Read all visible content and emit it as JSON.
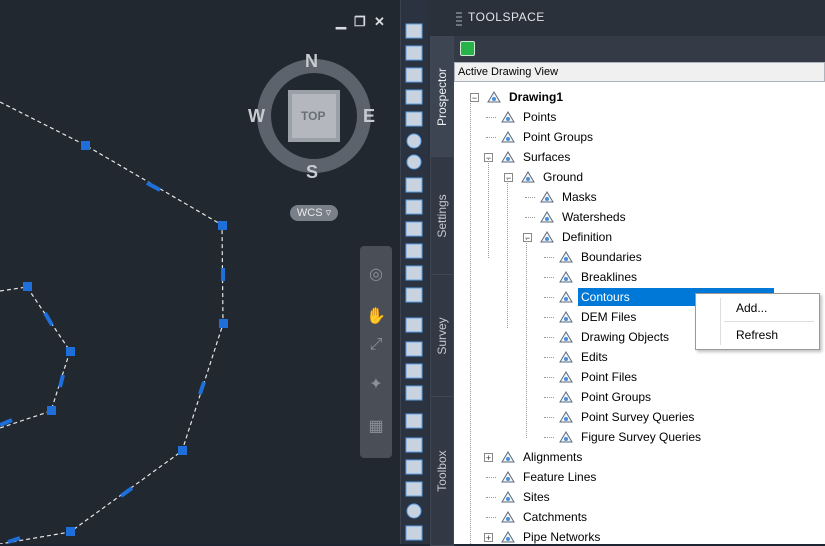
{
  "viewport": {
    "win_minimize": "▁",
    "win_restore": "❐",
    "win_close": "✕",
    "viewcube": {
      "north": "N",
      "south": "S",
      "east": "E",
      "west": "W",
      "face": "TOP"
    },
    "wcs_label": "WCS ▿",
    "navbar_icons": [
      "steering-wheel-icon",
      "pan-icon",
      "zoom-extents-icon",
      "orbit-icon",
      "showmotion-icon"
    ]
  },
  "toolspace": {
    "title": "TOOLSPACE",
    "tabs": [
      "Prospector",
      "Settings",
      "Survey",
      "Toolbox"
    ],
    "active_tab": "Prospector",
    "view_selector": "Active Drawing View",
    "tree": [
      {
        "label": "Drawing1",
        "level": 0,
        "expander": "−",
        "icon": "drawing-icon",
        "bold": true
      },
      {
        "label": "Points",
        "level": 1,
        "expander": "",
        "icon": "points-icon"
      },
      {
        "label": "Point Groups",
        "level": 1,
        "expander": "",
        "icon": "point-groups-icon"
      },
      {
        "label": "Surfaces",
        "level": 1,
        "expander": "−",
        "icon": "surfaces-icon"
      },
      {
        "label": "Ground",
        "level": 2,
        "expander": "−",
        "icon": "surface-icon"
      },
      {
        "label": "Masks",
        "level": 3,
        "expander": "",
        "icon": "masks-icon"
      },
      {
        "label": "Watersheds",
        "level": 3,
        "expander": "",
        "icon": "watersheds-icon"
      },
      {
        "label": "Definition",
        "level": 3,
        "expander": "−",
        "icon": "definition-icon"
      },
      {
        "label": "Boundaries",
        "level": 4,
        "expander": "",
        "icon": "boundaries-icon"
      },
      {
        "label": "Breaklines",
        "level": 4,
        "expander": "",
        "icon": "breaklines-icon"
      },
      {
        "label": "Contours",
        "level": 4,
        "expander": "",
        "icon": "contours-icon",
        "selected": true
      },
      {
        "label": "DEM Files",
        "level": 4,
        "expander": "",
        "icon": "dem-files-icon"
      },
      {
        "label": "Drawing Objects",
        "level": 4,
        "expander": "",
        "icon": "drawing-objects-icon"
      },
      {
        "label": "Edits",
        "level": 4,
        "expander": "",
        "icon": "edits-icon"
      },
      {
        "label": "Point Files",
        "level": 4,
        "expander": "",
        "icon": "point-files-icon"
      },
      {
        "label": "Point Groups",
        "level": 4,
        "expander": "",
        "icon": "point-groups-icon"
      },
      {
        "label": "Point Survey Queries",
        "level": 4,
        "expander": "",
        "icon": "point-survey-queries-icon"
      },
      {
        "label": "Figure Survey Queries",
        "level": 4,
        "expander": "",
        "icon": "figure-survey-queries-icon"
      },
      {
        "label": "Alignments",
        "level": 1,
        "expander": "+",
        "icon": "alignments-icon"
      },
      {
        "label": "Feature Lines",
        "level": 1,
        "expander": "",
        "icon": "feature-lines-icon"
      },
      {
        "label": "Sites",
        "level": 1,
        "expander": "",
        "icon": "sites-icon"
      },
      {
        "label": "Catchments",
        "level": 1,
        "expander": "",
        "icon": "catchments-icon"
      },
      {
        "label": "Pipe Networks",
        "level": 1,
        "expander": "+",
        "icon": "pipe-networks-icon"
      }
    ]
  },
  "context_menu": {
    "items": [
      "Add...",
      "Refresh"
    ]
  },
  "colors": {
    "viewport_bg": "#212830",
    "grip_blue": "#1e6fd9",
    "selection": "#0078d7",
    "panel_bg": "#2b313b"
  }
}
